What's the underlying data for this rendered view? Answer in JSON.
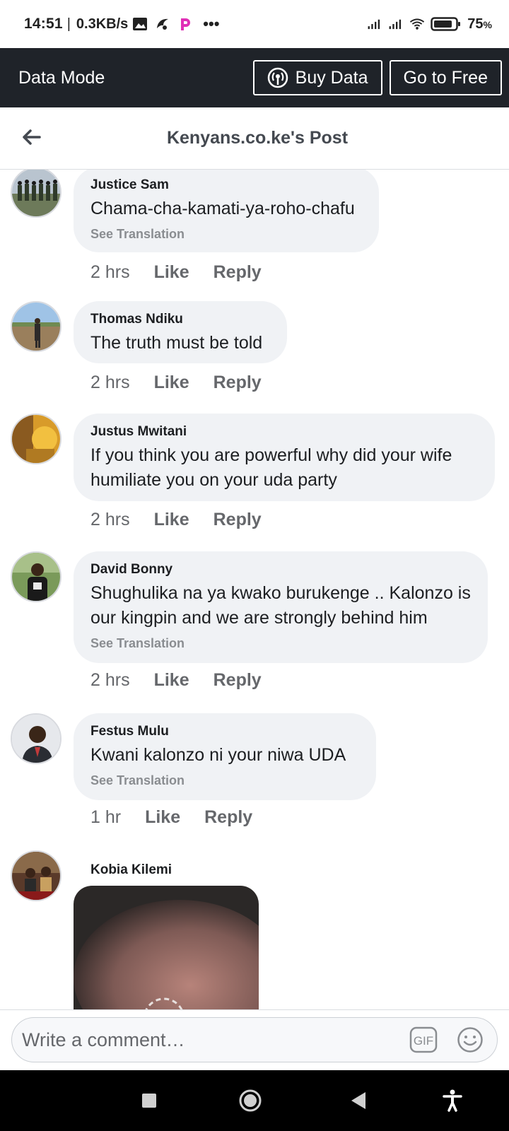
{
  "status_bar": {
    "time": "14:51",
    "separator": "|",
    "net_speed": "0.3KB/s",
    "more": "•••",
    "battery_pct": "75",
    "battery_unit": "%"
  },
  "data_banner": {
    "mode_label": "Data Mode",
    "buy_data_label": "Buy Data",
    "go_free_label": "Go to Free"
  },
  "header": {
    "title": "Kenyans.co.ke's Post",
    "back_icon": "arrow-left-icon"
  },
  "comments": [
    {
      "author": "Justice Sam",
      "text": "Chama-cha-kamati-ya-roho-chafu",
      "translation": "See Translation",
      "time": "2 hrs",
      "like": "Like",
      "reply": "Reply"
    },
    {
      "author": "Thomas Ndiku",
      "text": "The truth must be told",
      "time": "2 hrs",
      "like": "Like",
      "reply": "Reply"
    },
    {
      "author": "Justus Mwitani",
      "text": "If you think you are powerful why did your wife humiliate you on your uda party",
      "time": "2 hrs",
      "like": "Like",
      "reply": "Reply"
    },
    {
      "author": "David Bonny",
      "text": "Shughulika na ya kwako burukenge .. Kalonzo is our kingpin and we are strongly behind him",
      "translation": "See Translation",
      "time": "2 hrs",
      "like": "Like",
      "reply": "Reply"
    },
    {
      "author": "Festus Mulu",
      "text": "Kwani kalonzo ni your niwa UDA",
      "translation": "See Translation",
      "time": "1 hr",
      "like": "Like",
      "reply": "Reply"
    },
    {
      "author": "Kobia Kilemi"
    }
  ],
  "composer": {
    "placeholder": "Write a comment…",
    "gif_label": "GIF",
    "emoji_icon": "smiley-icon"
  },
  "colors": {
    "banner_bg": "#1f2329",
    "bubble_bg": "#f0f2f5",
    "meta_text": "#65676b"
  }
}
